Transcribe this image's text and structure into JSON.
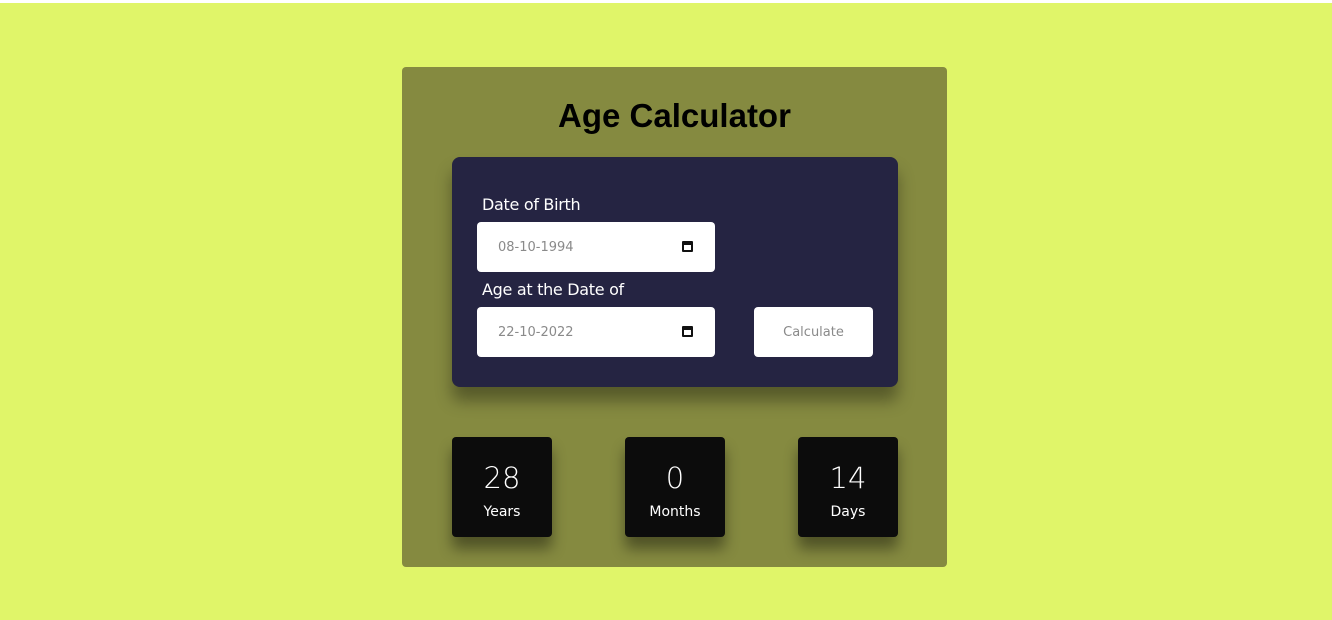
{
  "app": {
    "title": "Age Calculator"
  },
  "form": {
    "dob_label": "Date of Birth",
    "dob_value": "08-10-1994",
    "at_label": "Age at the Date of",
    "at_value": "22-10-2022",
    "calculate_label": "Calculate",
    "calendar_icon": "calendar-icon"
  },
  "results": {
    "years": {
      "value": "28",
      "label": "Years"
    },
    "months": {
      "value": "0",
      "label": "Months"
    },
    "days": {
      "value": "14",
      "label": "Days"
    }
  },
  "colors": {
    "page_background": "#e0f569",
    "panel": "#858a40",
    "card": "#252442",
    "result_box": "#0c0c0c"
  }
}
